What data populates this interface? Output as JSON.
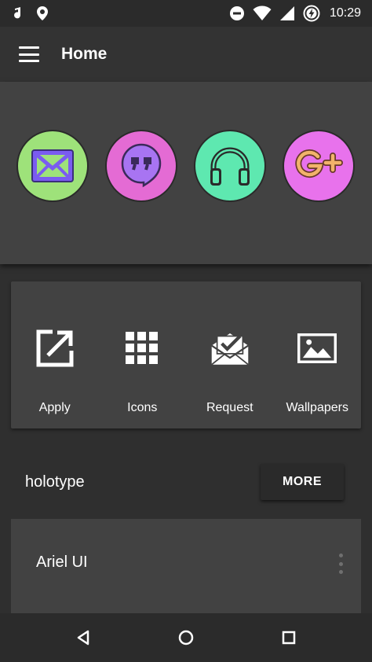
{
  "status_bar": {
    "time": "10:29",
    "icons": [
      "notification-icon",
      "location-icon",
      "do-not-disturb-icon",
      "wifi-icon",
      "signal-icon",
      "battery-charging-icon"
    ]
  },
  "app_bar": {
    "title": "Home",
    "menu_icon": "hamburger-menu-icon"
  },
  "preview": {
    "icons": [
      {
        "name": "gmail-icon",
        "bg": "#9ee27a",
        "fg": "#6e55e8"
      },
      {
        "name": "hangouts-icon",
        "bg": "#e46bd4",
        "fg": "#a972f0"
      },
      {
        "name": "headphones-icon",
        "bg": "#5ee8b0",
        "fg": "#2a2a2a"
      },
      {
        "name": "google-plus-icon",
        "bg": "#e872ec",
        "fg": "#f2b36a"
      }
    ]
  },
  "actions": [
    {
      "label": "Apply",
      "icon": "open-external-icon"
    },
    {
      "label": "Icons",
      "icon": "grid-icon"
    },
    {
      "label": "Request",
      "icon": "mail-check-icon"
    },
    {
      "label": "Wallpapers",
      "icon": "image-icon"
    }
  ],
  "section": {
    "title": "holotype",
    "more_label": "MORE"
  },
  "list": {
    "items": [
      {
        "title": "Ariel UI"
      }
    ]
  },
  "nav_bar": {
    "icons": [
      "back-icon",
      "home-icon",
      "recents-icon"
    ]
  },
  "colors": {
    "background": "#2f2f2f",
    "surface": "#424242",
    "app_bar": "#333333"
  }
}
